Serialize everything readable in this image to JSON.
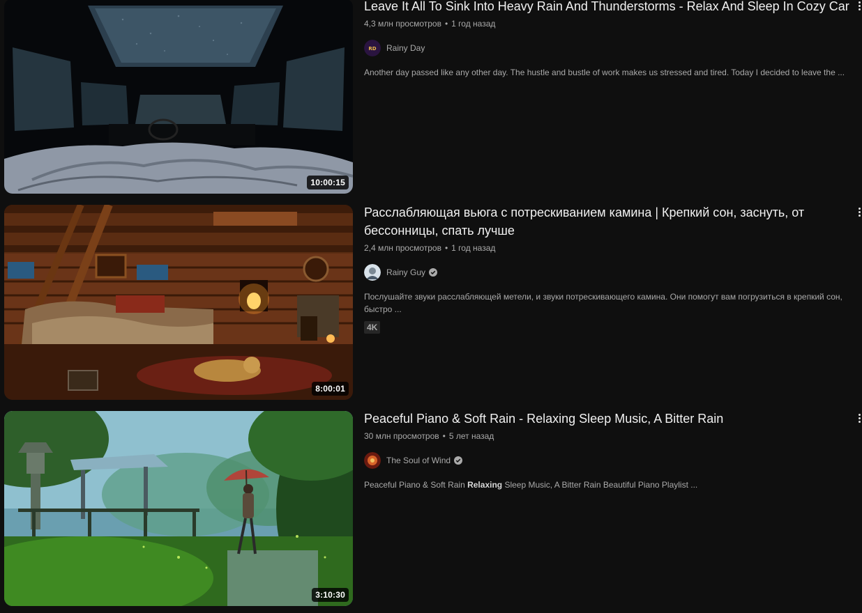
{
  "videos": [
    {
      "title": "Leave It All To Sink Into Heavy Rain And Thunderstorms - Relax And Sleep In Cozy Car",
      "views": "4,3 млн просмотров",
      "age": "1 год назад",
      "channel": "Rainy Day",
      "verified": false,
      "description": "Another day passed like any other day. The hustle and bustle of work makes us stressed and tired. Today I decided to leave the ...",
      "duration": "10:00:15",
      "thumbnail": "car-in-rain-thumbnail"
    },
    {
      "title": "Расслабляющая вьюга с потрескиванием камина | Крепкий сон, заснуть, от бессонницы, спать лучше",
      "views": "2,4 млн просмотров",
      "age": "1 год назад",
      "channel": "Rainy Guy",
      "verified": true,
      "description": "Послушайте звуки расслабляющей метели, и звуки потрескивающего камина. Они помогут вам погрузиться в крепкий сон, быстро ...",
      "badge": "4K",
      "duration": "8:00:01",
      "thumbnail": "cozy-cabin-fireplace-thumbnail"
    },
    {
      "title": "Peaceful Piano & Soft Rain - Relaxing Sleep Music, A Bitter Rain",
      "views": "30 млн просмотров",
      "age": "5 лет назад",
      "channel": "The Soul of Wind",
      "verified": true,
      "description_parts": [
        "Peaceful Piano & Soft Rain ",
        "Relaxing",
        " Sleep Music, A Bitter Rain Beautiful Piano Playlist ..."
      ],
      "duration": "3:10:30",
      "thumbnail": "girl-with-umbrella-rain-thumbnail"
    }
  ],
  "separator": "•",
  "colors": {
    "background": "#0f0f0f",
    "title": "#f1f1f1",
    "secondary_text": "#aaaaaa",
    "badge_bg": "#272727"
  }
}
